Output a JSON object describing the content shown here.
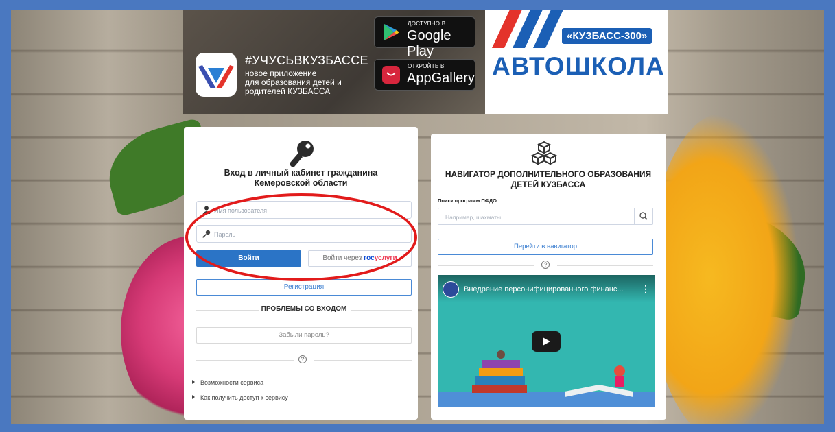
{
  "banner": {
    "app_title": "#УЧУСЬВКУЗБАССЕ",
    "app_subtitle_1": "новое приложение",
    "app_subtitle_2": "для образования детей и",
    "app_subtitle_3": "родителей КУЗБАССА",
    "google_small": "ДОСТУПНО В",
    "google_big": "Google Play",
    "appgallery_small": "ОТКРОЙТЕ В",
    "appgallery_big": "AppGallery",
    "autoschool_badge": "«КУЗБАСС-300»",
    "autoschool_title": "АВТОШКОЛА"
  },
  "login": {
    "title_line1": "Вход в личный кабинет гражданина",
    "title_line2": "Кемеровской области",
    "username_placeholder": "Имя пользователя",
    "password_placeholder": "Пароль",
    "login_button": "Войти",
    "gosuslugi_prefix": "Войти через ",
    "gosuslugi_part1": "гос",
    "gosuslugi_part2": "услуги",
    "register_button": "Регистрация",
    "problems_heading": "ПРОБЛЕМЫ СО ВХОДОМ",
    "forgot_button": "Забыли пароль?",
    "help_symbol": "?",
    "links": [
      "Возможности сервиса",
      "Как получить доступ к сервису"
    ]
  },
  "navigator": {
    "title_line1": "НАВИГАТОР ДОПОЛНИТЕЛЬНОГО ОБРАЗОВАНИЯ",
    "title_line2": "ДЕТЕЙ КУЗБАССА",
    "search_label": "Поиск программ ПФДО",
    "search_placeholder": "Например, шахматы...",
    "go_button": "Перейти в навигатор",
    "help_symbol": "?",
    "video_title": "Внедрение персонифицированного финанс...",
    "video_menu": "⋮"
  },
  "colors": {
    "frame": "#4a78c0",
    "primary": "#2b74c6",
    "highlight_oval": "#e21b1b"
  }
}
